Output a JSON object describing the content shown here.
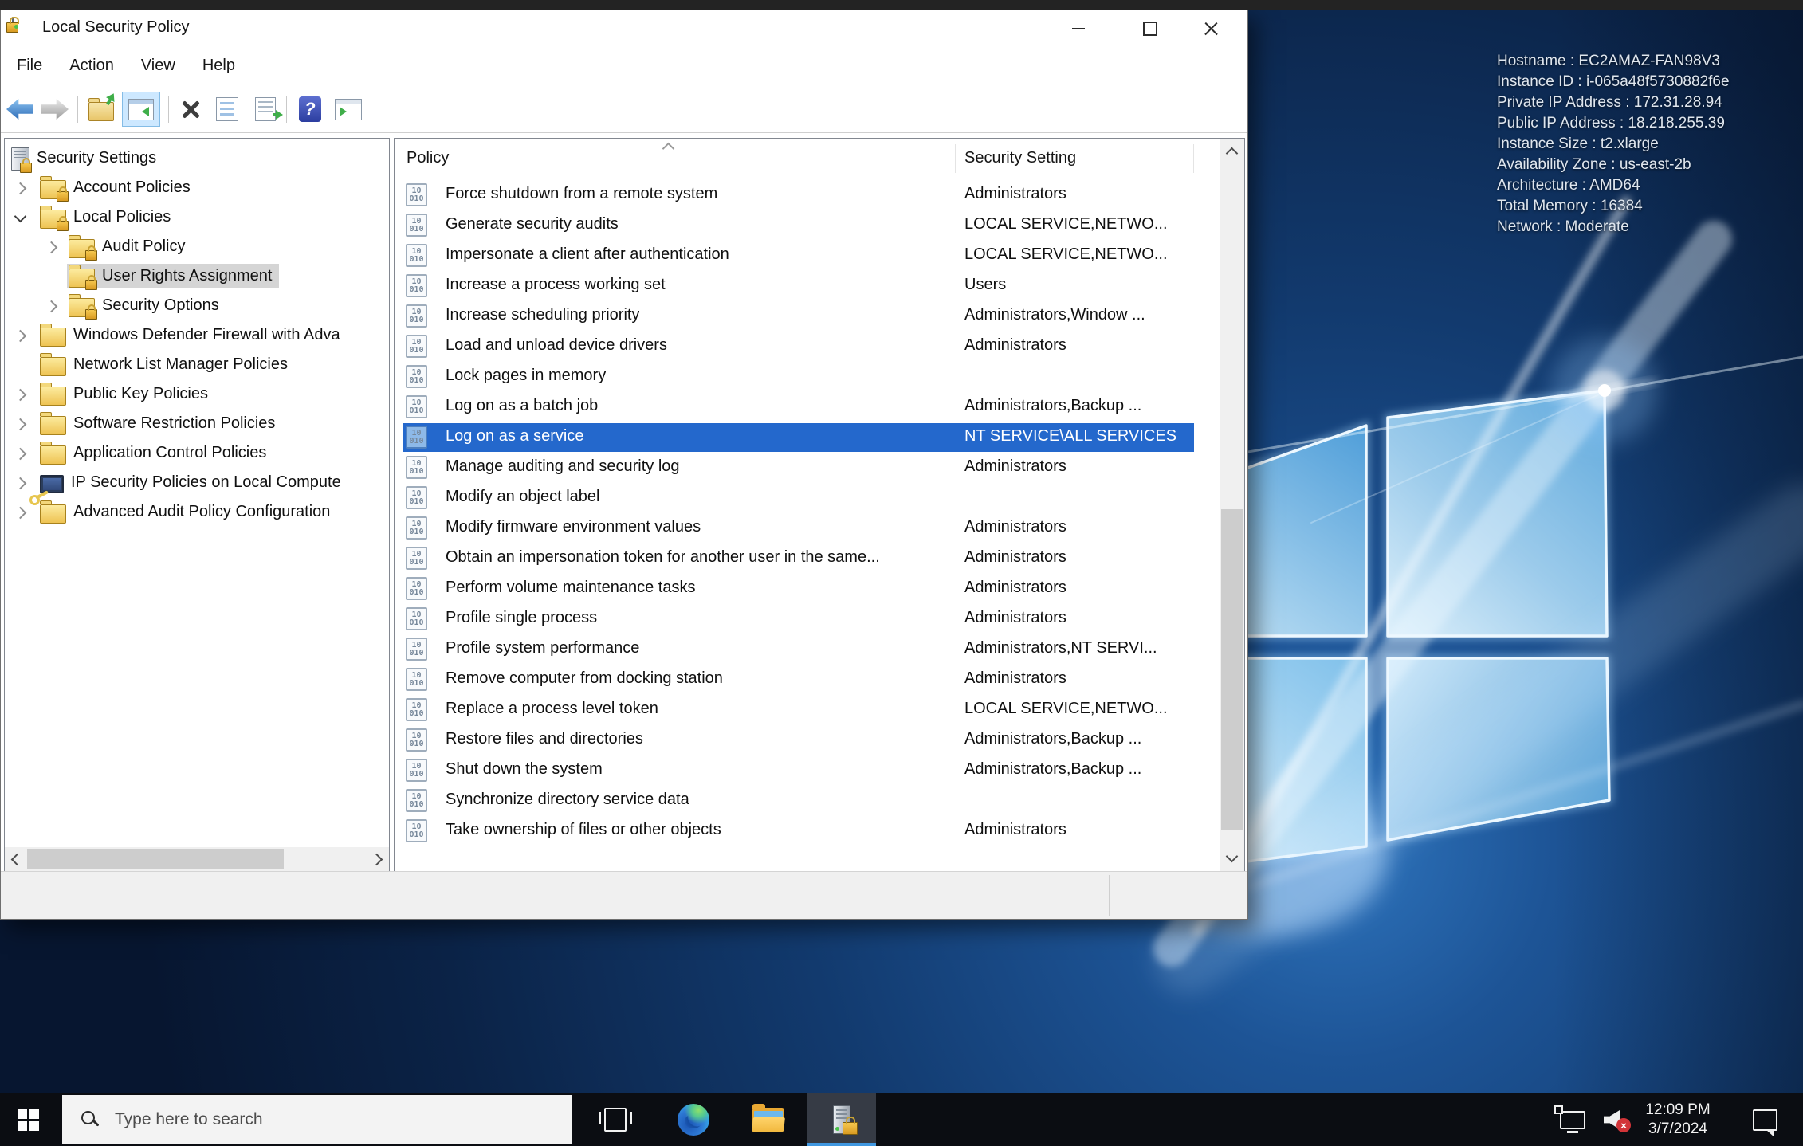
{
  "window": {
    "title": "Local Security Policy",
    "menu": [
      "File",
      "Action",
      "View",
      "Help"
    ],
    "tree": {
      "items": [
        {
          "label": "Security Settings",
          "level": 0,
          "icon": "computer-lock",
          "chevron": null,
          "selected": false
        },
        {
          "label": "Account Policies",
          "level": 1,
          "icon": "folder-lock",
          "chevron": "right",
          "selected": false
        },
        {
          "label": "Local Policies",
          "level": 1,
          "icon": "folder-lock",
          "chevron": "down",
          "selected": false
        },
        {
          "label": "Audit Policy",
          "level": 2,
          "icon": "folder-lock",
          "chevron": "right",
          "selected": false
        },
        {
          "label": "User Rights Assignment",
          "level": 2,
          "icon": "folder-lock",
          "chevron": null,
          "selected": true
        },
        {
          "label": "Security Options",
          "level": 2,
          "icon": "folder-lock",
          "chevron": "right",
          "selected": false
        },
        {
          "label": "Windows Defender Firewall with Adva",
          "level": 1,
          "icon": "folder",
          "chevron": "right",
          "selected": false
        },
        {
          "label": "Network List Manager Policies",
          "level": 1,
          "icon": "folder",
          "chevron": null,
          "selected": false
        },
        {
          "label": "Public Key Policies",
          "level": 1,
          "icon": "folder",
          "chevron": "right",
          "selected": false
        },
        {
          "label": "Software Restriction Policies",
          "level": 1,
          "icon": "folder",
          "chevron": "right",
          "selected": false
        },
        {
          "label": "Application Control Policies",
          "level": 1,
          "icon": "folder",
          "chevron": "right",
          "selected": false
        },
        {
          "label": "IP Security Policies on Local Compute",
          "level": 1,
          "icon": "monitor-key",
          "chevron": "right",
          "selected": false
        },
        {
          "label": "Advanced Audit Policy Configuration",
          "level": 1,
          "icon": "folder",
          "chevron": "right",
          "selected": false
        }
      ]
    },
    "list": {
      "columns": [
        "Policy",
        "Security Setting"
      ],
      "rows": [
        {
          "policy": "Force shutdown from a remote system",
          "setting": "Administrators",
          "selected": false
        },
        {
          "policy": "Generate security audits",
          "setting": "LOCAL SERVICE,NETWO...",
          "selected": false
        },
        {
          "policy": "Impersonate a client after authentication",
          "setting": "LOCAL SERVICE,NETWO...",
          "selected": false
        },
        {
          "policy": "Increase a process working set",
          "setting": "Users",
          "selected": false
        },
        {
          "policy": "Increase scheduling priority",
          "setting": "Administrators,Window ...",
          "selected": false
        },
        {
          "policy": "Load and unload device drivers",
          "setting": "Administrators",
          "selected": false
        },
        {
          "policy": "Lock pages in memory",
          "setting": "",
          "selected": false
        },
        {
          "policy": "Log on as a batch job",
          "setting": "Administrators,Backup ...",
          "selected": false
        },
        {
          "policy": "Log on as a service",
          "setting": "NT SERVICE\\ALL SERVICES",
          "selected": true
        },
        {
          "policy": "Manage auditing and security log",
          "setting": "Administrators",
          "selected": false
        },
        {
          "policy": "Modify an object label",
          "setting": "",
          "selected": false
        },
        {
          "policy": "Modify firmware environment values",
          "setting": "Administrators",
          "selected": false
        },
        {
          "policy": "Obtain an impersonation token for another user in the same...",
          "setting": "Administrators",
          "selected": false
        },
        {
          "policy": "Perform volume maintenance tasks",
          "setting": "Administrators",
          "selected": false
        },
        {
          "policy": "Profile single process",
          "setting": "Administrators",
          "selected": false
        },
        {
          "policy": "Profile system performance",
          "setting": "Administrators,NT SERVI...",
          "selected": false
        },
        {
          "policy": "Remove computer from docking station",
          "setting": "Administrators",
          "selected": false
        },
        {
          "policy": "Replace a process level token",
          "setting": "LOCAL SERVICE,NETWO...",
          "selected": false
        },
        {
          "policy": "Restore files and directories",
          "setting": "Administrators,Backup ...",
          "selected": false
        },
        {
          "policy": "Shut down the system",
          "setting": "Administrators,Backup ...",
          "selected": false
        },
        {
          "policy": "Synchronize directory service data",
          "setting": "",
          "selected": false
        },
        {
          "policy": "Take ownership of files or other objects",
          "setting": "Administrators",
          "selected": false
        }
      ]
    }
  },
  "desktop": {
    "system_info": [
      "Hostname : EC2AMAZ-FAN98V3",
      "Instance ID : i-065a48f5730882f6e",
      "Private IP Address : 172.31.28.94",
      "Public IP Address : 18.218.255.39",
      "Instance Size : t2.xlarge",
      "Availability Zone : us-east-2b",
      "Architecture : AMD64",
      "Total Memory : 16384",
      "Network : Moderate"
    ]
  },
  "taskbar": {
    "search_placeholder": "Type here to search",
    "clock": {
      "time": "12:09 PM",
      "date": "3/7/2024"
    }
  },
  "colors": {
    "selection_blue": "#2468cc",
    "tree_selection_gray": "#d5d5d5",
    "taskbar_underline": "#3f97e0"
  }
}
